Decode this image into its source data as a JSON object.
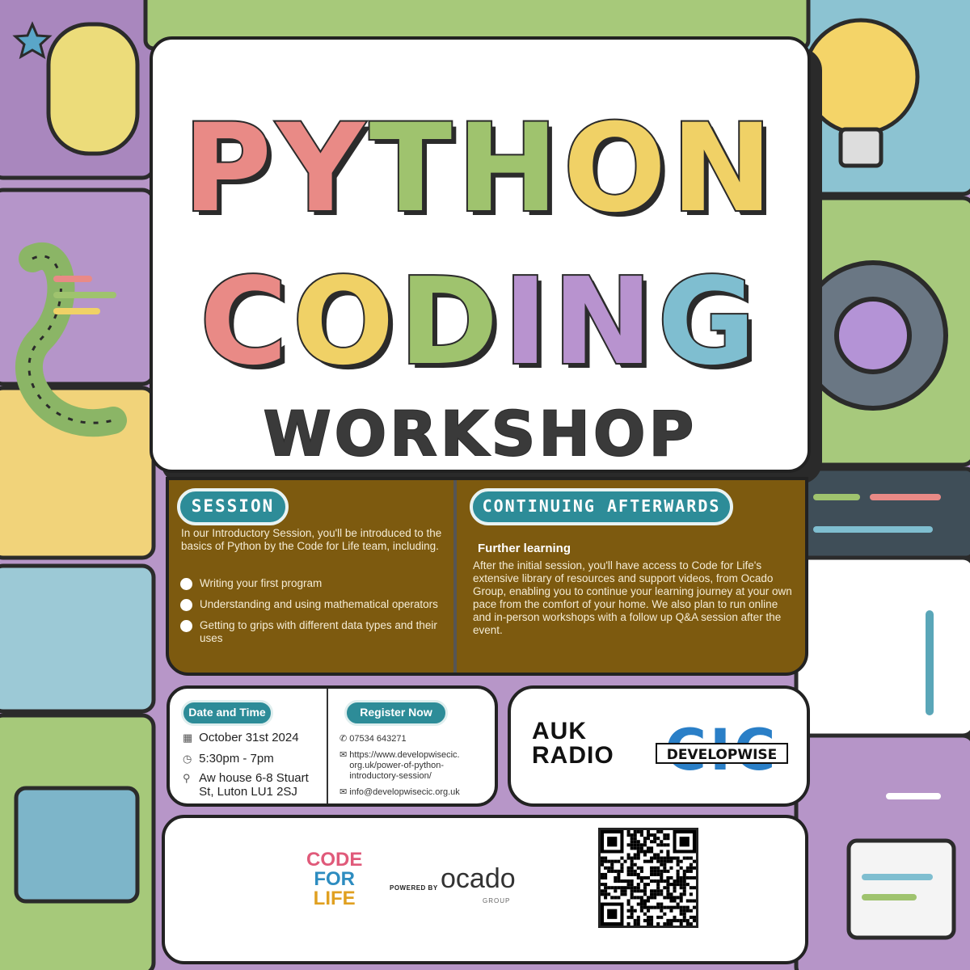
{
  "title": {
    "line1": [
      "P",
      "Y",
      "T",
      "H",
      "O",
      "N"
    ],
    "line1_colors": [
      "#e98a86",
      "#e98a86",
      "#9fc36e",
      "#9fc36e",
      "#f0d166",
      "#f0d166"
    ],
    "line2": [
      "C",
      "O",
      "D",
      "I",
      "N",
      "G"
    ],
    "line2_colors": [
      "#e98a86",
      "#f0d166",
      "#9fc36e",
      "#b893cf",
      "#b893cf",
      "#7fbed0"
    ],
    "line3": "WORKSHOP"
  },
  "session": {
    "heading": "SESSION",
    "intro": "In our Introductory Session, you'll be introduced to the basics of Python by the Code for Life team, including.",
    "bullets": [
      "Writing your first program",
      "Understanding and using mathematical operators",
      "Getting to grips with different data types and their uses"
    ]
  },
  "continuing": {
    "heading": "CONTINUING AFTERWARDS",
    "subheading": "Further learning",
    "body": "After the initial session, you'll have access to Code for Life's extensive library of resources and support videos, from Ocado Group, enabling you to continue your learning journey at your own pace from the comfort of your home. We also plan to run online and in-person workshops with a follow up Q&A session after the event."
  },
  "date_time": {
    "heading": "Date and Time",
    "date": "October 31st 2024",
    "time": "5:30pm - 7pm",
    "address_line1": "Aw house 6-8 Stuart",
    "address_line2": "St, Luton LU1 2SJ",
    "icons": [
      "calendar-icon",
      "clock-icon",
      "location-pin-icon"
    ]
  },
  "register": {
    "heading": "Register Now",
    "phone": "07534 643271",
    "url_line1": "https://www.developwisecic.",
    "url_line2": "org.uk/power-of-python-",
    "url_line3": "introductory-session/",
    "email": "info@developwisecic.org.uk",
    "icons": [
      "phone-icon",
      "mail-icon",
      "mail-icon"
    ]
  },
  "sponsors": {
    "auk_line1": "AUK",
    "auk_line2": "RADIO",
    "cic_big": "CIC",
    "cic_name": "DEVELOPWISE"
  },
  "footer": {
    "cfl_line1": "CODE",
    "cfl_line2": "FOR",
    "cfl_line3": "LIFE",
    "powered_by": "POWERED BY",
    "ocado": "ocado",
    "ocado_group": "GROUP"
  },
  "colors": {
    "teal": "#2d8c98",
    "brown_panel": "#7d5a0f",
    "pink": "#e98a86",
    "green": "#9fc36e",
    "yellow": "#f0d166",
    "purple": "#b893cf",
    "blue": "#7fbed0",
    "developwise_blue": "#2a7fc7"
  }
}
